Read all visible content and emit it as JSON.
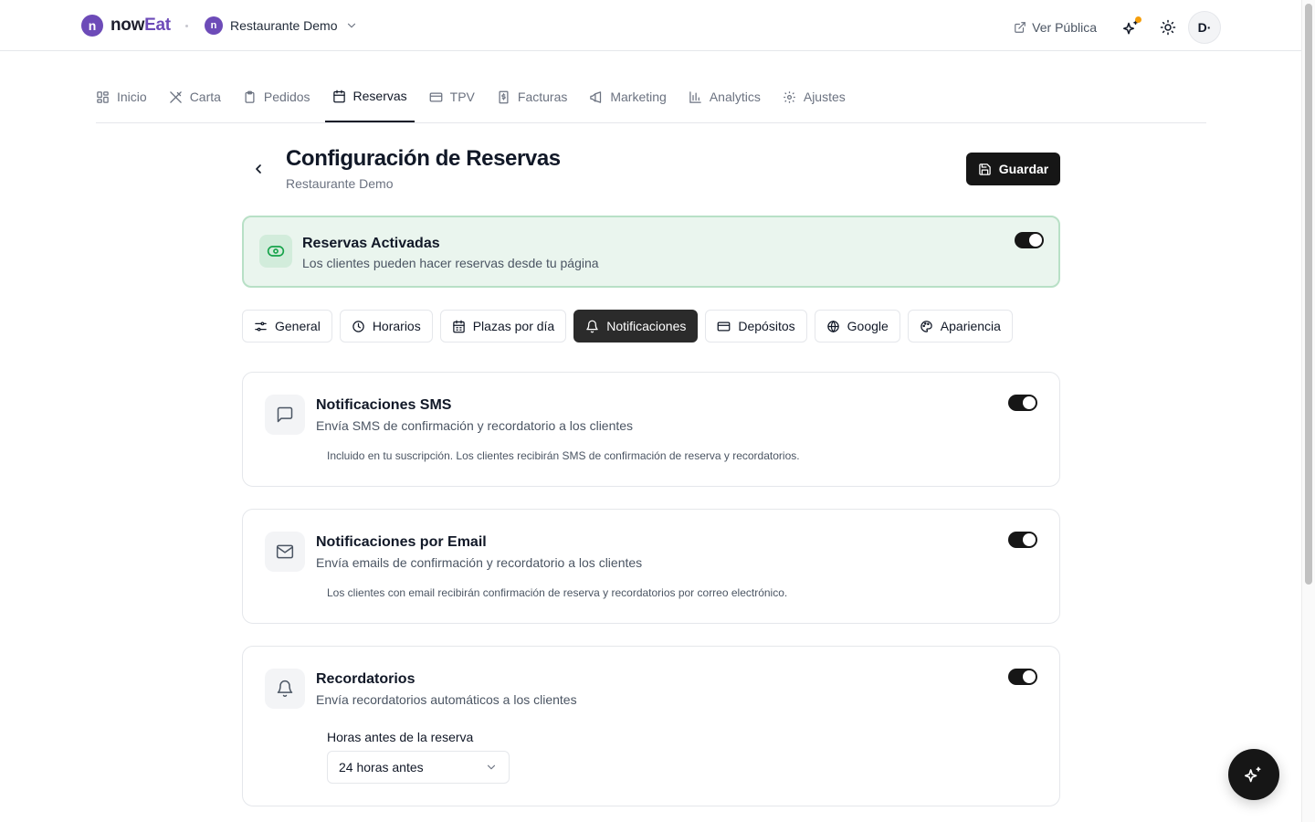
{
  "brand": {
    "logo_letter": "n",
    "name_part1": "now",
    "name_part2": "Eat",
    "color": "#6d4bb8"
  },
  "restaurant": {
    "logo_letter": "n",
    "name": "Restaurante Demo"
  },
  "header": {
    "view_public": "Ver Pública",
    "avatar": "D·",
    "notification_dot_color": "#f59e0b"
  },
  "nav": {
    "items": [
      {
        "label": "Inicio",
        "icon": "grid-icon"
      },
      {
        "label": "Carta",
        "icon": "utensils-icon"
      },
      {
        "label": "Pedidos",
        "icon": "clipboard-icon"
      },
      {
        "label": "Reservas",
        "icon": "calendar-icon",
        "active": true
      },
      {
        "label": "TPV",
        "icon": "credit-card-icon"
      },
      {
        "label": "Facturas",
        "icon": "receipt-icon"
      },
      {
        "label": "Marketing",
        "icon": "megaphone-icon"
      },
      {
        "label": "Analytics",
        "icon": "bar-chart-icon"
      },
      {
        "label": "Ajustes",
        "icon": "gear-icon"
      }
    ]
  },
  "page": {
    "title": "Configuración de Reservas",
    "subtitle": "Restaurante Demo",
    "save_label": "Guardar"
  },
  "banner": {
    "title": "Reservas Activadas",
    "subtitle": "Los clientes pueden hacer reservas desde tu página",
    "enabled": true,
    "accent": "#16a34a"
  },
  "section_tabs": [
    {
      "label": "General",
      "icon": "sliders-icon"
    },
    {
      "label": "Horarios",
      "icon": "clock-icon"
    },
    {
      "label": "Plazas por día",
      "icon": "calendar-icon"
    },
    {
      "label": "Notificaciones",
      "icon": "bell-icon",
      "active": true
    },
    {
      "label": "Depósitos",
      "icon": "credit-card-icon"
    },
    {
      "label": "Google",
      "icon": "globe-icon"
    },
    {
      "label": "Apariencia",
      "icon": "palette-icon"
    }
  ],
  "cards": {
    "sms": {
      "title": "Notificaciones SMS",
      "subtitle": "Envía SMS de confirmación y recordatorio a los clientes",
      "note": "Incluido en tu suscripción. Los clientes recibirán SMS de confirmación de reserva y recordatorios.",
      "enabled": true
    },
    "email": {
      "title": "Notificaciones por Email",
      "subtitle": "Envía emails de confirmación y recordatorio a los clientes",
      "note": "Los clientes con email recibirán confirmación de reserva y recordatorios por correo electrónico.",
      "enabled": true
    },
    "reminders": {
      "title": "Recordatorios",
      "subtitle": "Envía recordatorios automáticos a los clientes",
      "field_label": "Horas antes de la reserva",
      "select_value": "24 horas antes",
      "enabled": true
    }
  }
}
